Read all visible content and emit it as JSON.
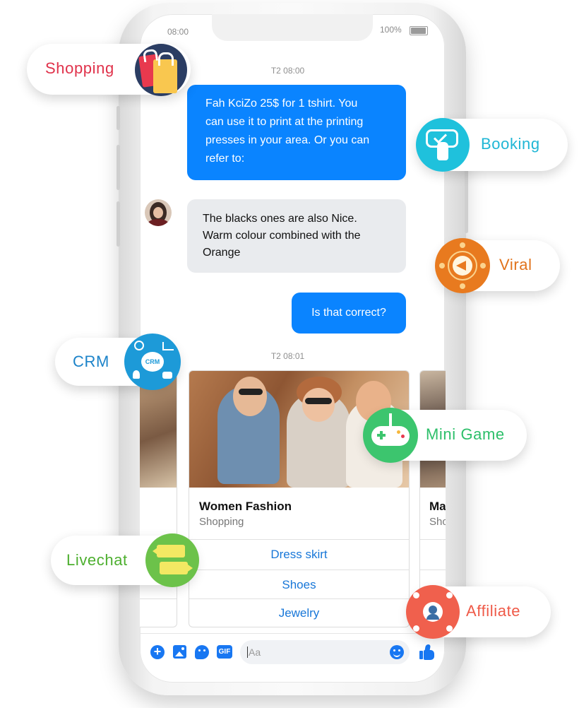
{
  "status_bar": {
    "time": "08:00",
    "battery": "100%"
  },
  "chat": {
    "timestamp_1": "T2 08:00",
    "message_out_1": [
      "Fah KciZo 25$ for 1 tshirt. You",
      "can use it to print at the printing",
      "presses in your area. Or you can",
      "refer to:"
    ],
    "message_in_1": [
      "The blacks ones are also Nice.",
      "Warm colour combined with the",
      "Orange"
    ],
    "message_out_2": "Is that correct?",
    "timestamp_2": "T2 08:01"
  },
  "carousel": {
    "card_title": "Women Fashion",
    "card_subtitle": "Shopping",
    "buttons": [
      "Dress skirt",
      "Shoes",
      "Jewelry"
    ],
    "next_card_title": "Ma",
    "next_card_subtitle": "Sho"
  },
  "composer": {
    "placeholder": "Aa",
    "gif_label": "GIF"
  },
  "features": [
    {
      "label": "Shopping",
      "color": "#e0324b"
    },
    {
      "label": "Booking",
      "color": "#1fb6d5"
    },
    {
      "label": "Viral",
      "color": "#e1731c"
    },
    {
      "label": "CRM",
      "color": "#1c83c9"
    },
    {
      "label": "Mini Game",
      "color": "#2dbf6a"
    },
    {
      "label": "Livechat",
      "color": "#4daf2f"
    },
    {
      "label": "Affiliate",
      "color": "#ef5a48"
    }
  ],
  "badges": {
    "crm_icon_text": "CRM"
  },
  "colors": {
    "messenger_blue": "#0a84ff",
    "link_blue": "#1877d8",
    "bubble_gray": "#e9ebee"
  }
}
